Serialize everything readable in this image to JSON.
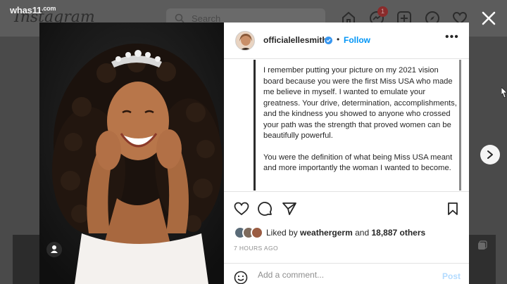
{
  "watermark": {
    "text": "whas11",
    "suffix": ".com"
  },
  "background": {
    "logo": "Instagram",
    "search_placeholder": "Search",
    "notification_count": "1"
  },
  "post": {
    "username": "officialellesmith",
    "separator": "•",
    "follow_label": "Follow",
    "more_label": "•••",
    "caption": [
      "I remember putting your picture on my 2021 vision board because you were the first Miss USA who made me believe in myself. I wanted to emulate your greatness. Your drive, determination, accomplishments, and the kindness you showed to anyone who crossed your path was the strength that proved women can be beautifully powerful.",
      "You were the definition of what being Miss USA meant and more importantly the woman I wanted to become."
    ],
    "likes": {
      "prefix": "Liked by",
      "user": "weathergerm",
      "and": "and",
      "count": "18,887 others"
    },
    "timestamp": "7 HOURS AGO",
    "comment_placeholder": "Add a comment...",
    "post_label": "Post"
  },
  "icons": {
    "close": "close-icon",
    "next": "chevron-right-icon",
    "like": "heart-icon",
    "comment": "comment-icon",
    "share": "send-icon",
    "save": "bookmark-icon",
    "emoji": "smiley-icon",
    "tag": "user-tag-icon",
    "verified": "verified-badge-icon"
  },
  "colors": {
    "accent": "#0095f6",
    "post_disabled": "#b3dbff",
    "text": "#262626",
    "muted": "#8e8e8e",
    "overlay": "#4a4a4a"
  }
}
